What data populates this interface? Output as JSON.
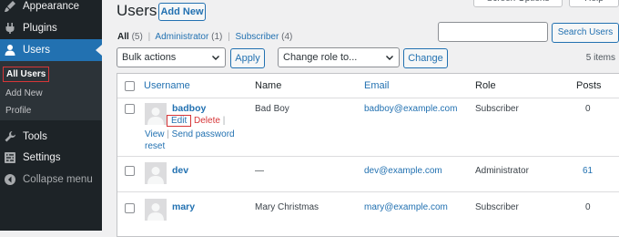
{
  "top_bar": {
    "screen_options": "Screen Options",
    "help": "Help"
  },
  "sidebar": {
    "menu": [
      {
        "label": "Appearance",
        "icon": "paintbrush-icon"
      },
      {
        "label": "Plugins",
        "icon": "plugin-icon"
      },
      {
        "label": "Users",
        "icon": "user-icon"
      },
      {
        "label": "Tools",
        "icon": "wrench-icon"
      },
      {
        "label": "Settings",
        "icon": "settings-icon"
      },
      {
        "label": "Collapse menu",
        "icon": "collapse-icon"
      }
    ],
    "submenu": [
      "All Users",
      "Add New",
      "Profile"
    ]
  },
  "page": {
    "title": "Users",
    "add_new": "Add New"
  },
  "filters": {
    "all": "All",
    "all_count": "(5)",
    "administrator": "Administrator",
    "administrator_count": "(1)",
    "subscriber": "Subscriber",
    "subscriber_count": "(4)",
    "separator": "|"
  },
  "search": {
    "placeholder": "",
    "button": "Search Users"
  },
  "bulk_actions": {
    "selected": "Bulk actions",
    "apply": "Apply"
  },
  "change_role": {
    "selected": "Change role to...",
    "button": "Change"
  },
  "items_count": "5 items",
  "table": {
    "headers": {
      "username": "Username",
      "name": "Name",
      "email": "Email",
      "role": "Role",
      "posts": "Posts"
    },
    "rows": [
      {
        "username": "badboy",
        "name": "Bad Boy",
        "email": "badboy@example.com",
        "role": "Subscriber",
        "posts": "0"
      },
      {
        "username": "dev",
        "name": "—",
        "email": "dev@example.com",
        "role": "Administrator",
        "posts": "61"
      },
      {
        "username": "mary",
        "name": "Mary Christmas",
        "email": "mary@example.com",
        "role": "Subscriber",
        "posts": "0"
      }
    ],
    "row_actions": {
      "edit": "Edit",
      "delete": "Delete",
      "view": "View",
      "send_password": "Send password",
      "reset": "reset",
      "separator": "|"
    }
  },
  "colors": {
    "accent": "#2271b1",
    "sidebar_bg": "#1d2327",
    "highlight": "#d63638"
  }
}
